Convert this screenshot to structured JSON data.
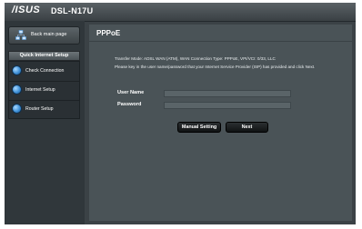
{
  "header": {
    "brand": "/ISUS",
    "model": "DSL-N17U"
  },
  "sidebar": {
    "back_label": "Back main page",
    "section_title": "Quick Internet Setup",
    "items": [
      {
        "label": "Check Connection"
      },
      {
        "label": "Internet Setup"
      },
      {
        "label": "Router Setup"
      }
    ]
  },
  "main": {
    "title": "PPPoE",
    "transfer_mode": "Transfer Mode: ADSL WAN (ATM), WAN Connection Type: PPPoE, VPI/VCI: 0/33, LLC",
    "instruction": "Please key in the user name/password that your Internet Service Provider (ISP) has provided and click Next.",
    "username_label": "User Name",
    "username_value": "",
    "password_label": "Password",
    "password_value": "",
    "manual_button": "Manual Setting",
    "next_button": "Next"
  },
  "colors": {
    "background": "#3b4246",
    "content_panel": "#4a5357",
    "menu_icon": "#3e8fd6"
  },
  "icons": {
    "back": "home-network-icon",
    "menu_item": "blue-circle-icon"
  }
}
